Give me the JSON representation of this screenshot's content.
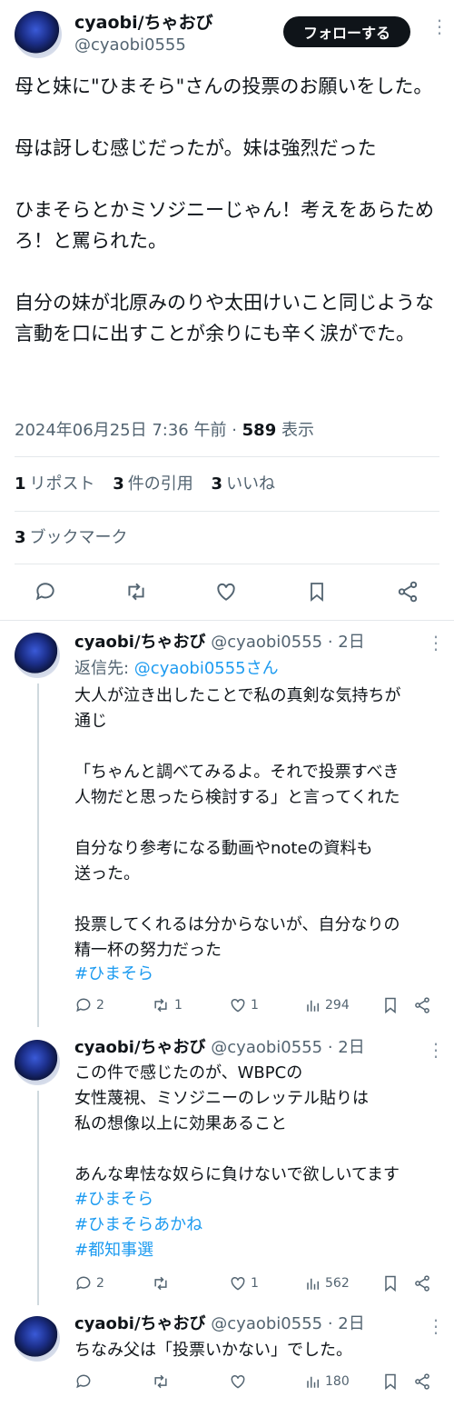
{
  "main": {
    "author_name": "cyaobi/ちゃおび",
    "author_handle": "@cyaobi0555",
    "follow_label": "フォローする",
    "text": "母と妹に\"ひまそら\"さんの投票のお願いをした。\n\n母は訝しむ感じだったが。妹は強烈だった\n\nひまそらとかミソジニーじゃん！考えをあらためろ！と罵られた。\n\n自分の妹が北原みのりや太田けいこと同じような言動を口に出すことが余りにも辛く涙がでた。",
    "timestamp": "2024年06月25日 7:36 午前",
    "sep": " · ",
    "views_count": "589",
    "views_label": " 表示",
    "stats": {
      "reposts_count": "1",
      "reposts_label": "リポスト",
      "quotes_count": "3",
      "quotes_label": "件の引用",
      "likes_count": "3",
      "likes_label": "いいね"
    },
    "bookmarks_count": "3",
    "bookmarks_label": "ブックマーク"
  },
  "replies": [
    {
      "author_name": "cyaobi/ちゃおび",
      "author_handle": "@cyaobi0555",
      "time": " · 2日",
      "reply_to_label": "返信先: ",
      "reply_to_handle": "@cyaobi0555さん",
      "text": "大人が泣き出したことで私の真剣な気持ちが\n通じ\n\n「ちゃんと調べてみるよ。それで投票すべき\n人物だと思ったら検討する」と言ってくれた\n\n自分なり参考になる動画やnoteの資料も\n送った。\n\n投票してくれるは分からないが、自分なりの\n精一杯の努力だった",
      "hashtags": [
        "#ひまそら"
      ],
      "replies": "2",
      "reposts": "1",
      "likes": "1",
      "views": "294"
    },
    {
      "author_name": "cyaobi/ちゃおび",
      "author_handle": "@cyaobi0555",
      "time": " · 2日",
      "text": "この件で感じたのが、WBPCの\n女性蔑視、ミソジニーのレッテル貼りは\n私の想像以上に効果あること\n\nあんな卑怯な奴らに負けないで欲しいてます",
      "hashtags": [
        "#ひまそら",
        "#ひまそらあかね",
        "#都知事選"
      ],
      "replies": "2",
      "reposts": "",
      "likes": "1",
      "views": "562"
    },
    {
      "author_name": "cyaobi/ちゃおび",
      "author_handle": "@cyaobi0555",
      "time": " · 2日",
      "text": "ちなみ父は「投票いかない」でした。",
      "hashtags": [],
      "replies": "",
      "reposts": "",
      "likes": "",
      "views": "180"
    }
  ],
  "colors": {
    "link": "#1d9bf0",
    "muted": "#536471",
    "text": "#0f1419",
    "divider": "#e4e8eb"
  },
  "icons": [
    "reply-icon",
    "repost-icon",
    "like-icon",
    "bookmark-icon",
    "share-icon",
    "views-icon",
    "more-icon"
  ]
}
